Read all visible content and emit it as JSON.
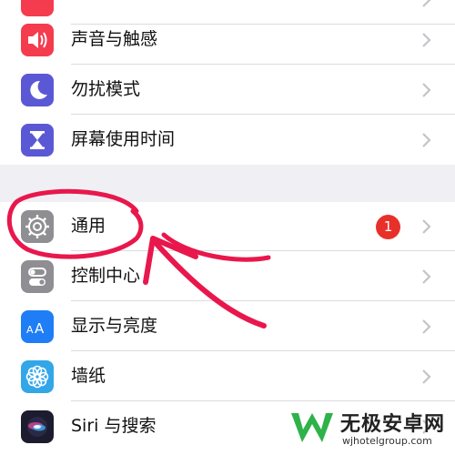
{
  "settings": {
    "group1": {
      "items": [
        {
          "label": "",
          "icon": "red-app-icon",
          "color": "#f53b4e"
        },
        {
          "label": "声音与触感",
          "icon": "speaker-icon",
          "color": "#f53b4e"
        },
        {
          "label": "勿扰模式",
          "icon": "moon-icon",
          "color": "#5b58d6"
        },
        {
          "label": "屏幕使用时间",
          "icon": "hourglass-icon",
          "color": "#5b58d6"
        }
      ]
    },
    "group2": {
      "items": [
        {
          "label": "通用",
          "icon": "gear-icon",
          "color": "#8e8e93",
          "badge": "1"
        },
        {
          "label": "控制中心",
          "icon": "toggle-switches-icon",
          "color": "#8e8e93"
        },
        {
          "label": "显示与亮度",
          "icon": "text-size-icon",
          "color": "#1f7ef5"
        },
        {
          "label": "墙纸",
          "icon": "flower-icon",
          "color": "#33a6e8"
        },
        {
          "label": "Siri 与搜索",
          "icon": "siri-icon",
          "color": "#1c1c2e"
        }
      ]
    }
  },
  "annotation": {
    "color": "#e8174c",
    "shapes": [
      "circle-around-general",
      "arrow-to-general"
    ]
  },
  "watermark": {
    "title": "无极安卓网",
    "url": "wjhotelgroup.com",
    "logo_color": "#2eb24a"
  }
}
